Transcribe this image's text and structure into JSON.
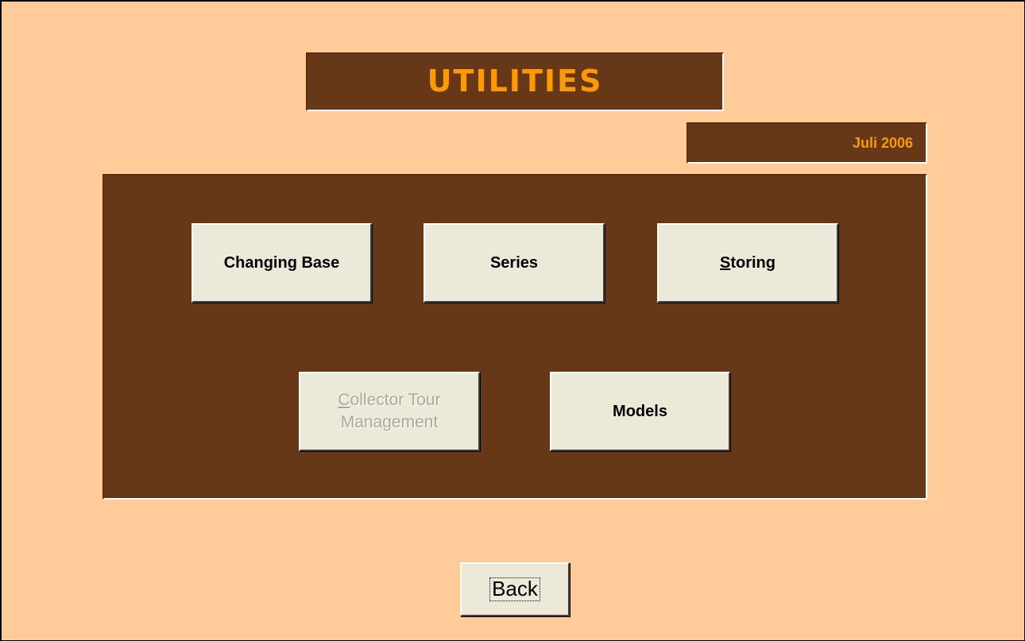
{
  "title": "UTILITIES",
  "date_label": "Juli 2006",
  "buttons": {
    "changing_base": "Changing Base",
    "series": "Series",
    "storing": {
      "mnemonic": "S",
      "rest": "toring"
    },
    "collector_tour_management": {
      "mnemonic": "C",
      "rest": "ollector Tour",
      "line2": "Management",
      "enabled": false
    },
    "models": "Models",
    "back": "Back"
  },
  "colors": {
    "background": "#ffcc99",
    "panel": "#663818",
    "accent": "#ff9900",
    "button_face": "#ece9d8",
    "disabled_text": "#aca899"
  }
}
